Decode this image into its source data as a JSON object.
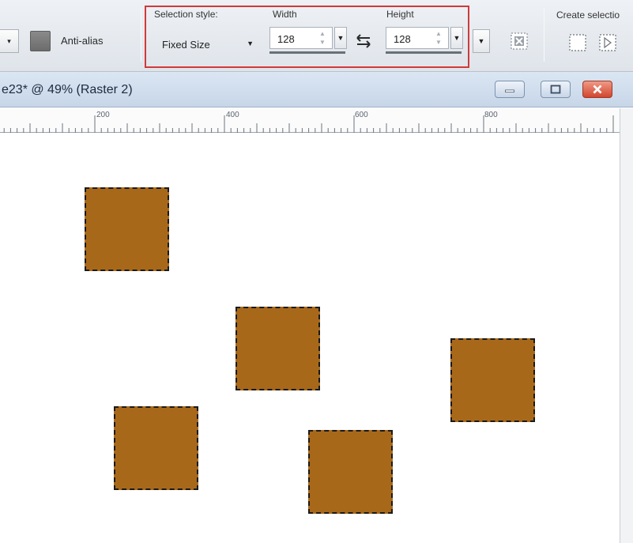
{
  "toolbar": {
    "antialias_label": "Anti-alias",
    "selection_style_label": "Selection style:",
    "selection_style_value": "Fixed Size",
    "width_label": "Width",
    "width_value": "128",
    "height_label": "Height",
    "height_value": "128",
    "create_selection_label": "Create selectio",
    "highlight_color": "#d03a3a"
  },
  "document": {
    "title": "e23* @ 49% (Raster 2)"
  },
  "ruler": {
    "labels": [
      "200",
      "400",
      "600",
      "800"
    ]
  },
  "canvas": {
    "shape_color": "#a8681a",
    "selection_count": 5
  },
  "icons": [
    "swap-icon",
    "select-all-icon",
    "create-selection-icon",
    "create-selection-from-mask-icon",
    "minimize-icon",
    "maximize-icon",
    "close-icon"
  ]
}
